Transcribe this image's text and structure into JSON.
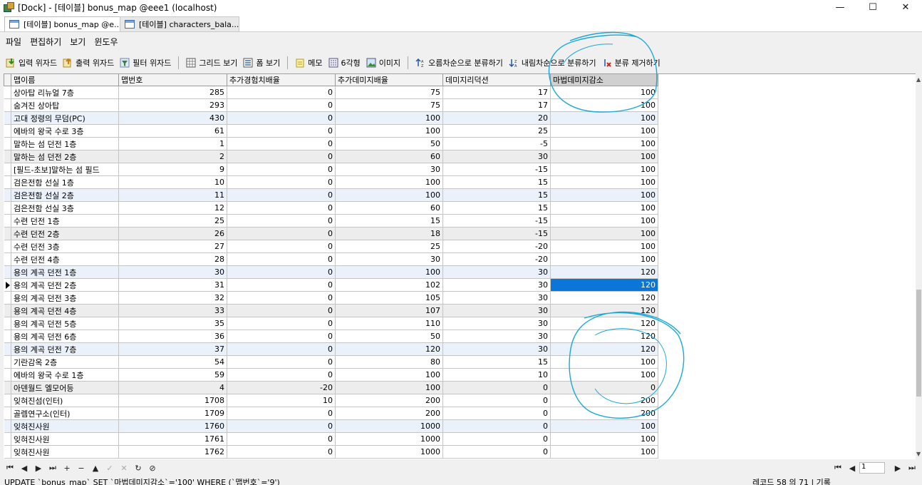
{
  "window": {
    "title": "[Dock] - [테이블] bonus_map @eee1 (localhost)"
  },
  "window_controls": {
    "minimize": "—",
    "maximize": "☐",
    "close": "✕"
  },
  "tabs": [
    {
      "label": "[테이블] bonus_map @e..."
    },
    {
      "label": "[테이블] characters_bala..."
    }
  ],
  "menu": [
    "파일",
    "편집하기",
    "보기",
    "윈도우"
  ],
  "toolbar": [
    "입력 위자드",
    "출력 위자드",
    "필터 위자드",
    "그리드 보기",
    "폼 보기",
    "메모",
    "6각형",
    "이미지",
    "오름차순으로 분류하기",
    "내림차순으로 분류하기",
    "분류 제거하기"
  ],
  "columns": [
    "맵이름",
    "맵번호",
    "추가경험치배율",
    "추가데미지배율",
    "데미지리덕션",
    "마법데미지감소"
  ],
  "rows": [
    {
      "name": "상아탑 리뉴얼 7층",
      "vals": [
        "285",
        "0",
        "75",
        "17",
        "100"
      ]
    },
    {
      "name": "숨겨진 상아탑",
      "vals": [
        "293",
        "0",
        "75",
        "17",
        "100"
      ]
    },
    {
      "name": "고대 정령의 무덤(PC)",
      "vals": [
        "430",
        "0",
        "100",
        "20",
        "100"
      ]
    },
    {
      "name": "에바의 왕국 수로 3층",
      "vals": [
        "61",
        "0",
        "100",
        "25",
        "100"
      ]
    },
    {
      "name": "말하는 섬 던전 1층",
      "vals": [
        "1",
        "0",
        "50",
        "-5",
        "100"
      ]
    },
    {
      "name": "말하는 섬 던전 2층",
      "vals": [
        "2",
        "0",
        "60",
        "30",
        "100"
      ]
    },
    {
      "name": "[필드-초보]말하는 섬 필드",
      "vals": [
        "9",
        "0",
        "30",
        "-15",
        "100"
      ]
    },
    {
      "name": "검은전함 선실 1층",
      "vals": [
        "10",
        "0",
        "100",
        "15",
        "100"
      ]
    },
    {
      "name": "검은전함 선실 2층",
      "vals": [
        "11",
        "0",
        "100",
        "15",
        "100"
      ]
    },
    {
      "name": "검은전함 선실 3층",
      "vals": [
        "12",
        "0",
        "60",
        "15",
        "100"
      ]
    },
    {
      "name": "수련 던전 1층",
      "vals": [
        "25",
        "0",
        "15",
        "-15",
        "100"
      ]
    },
    {
      "name": "수련 던전 2층",
      "vals": [
        "26",
        "0",
        "18",
        "-15",
        "100"
      ]
    },
    {
      "name": "수련 던전 3층",
      "vals": [
        "27",
        "0",
        "25",
        "-20",
        "100"
      ]
    },
    {
      "name": "수련 던전 4층",
      "vals": [
        "28",
        "0",
        "30",
        "-20",
        "100"
      ]
    },
    {
      "name": "용의 계곡 던전 1층",
      "vals": [
        "30",
        "0",
        "100",
        "30",
        "120"
      ]
    },
    {
      "name": "용의 계곡 던전 2층",
      "vals": [
        "31",
        "0",
        "102",
        "30",
        "120"
      ]
    },
    {
      "name": "용의 계곡 던전 3층",
      "vals": [
        "32",
        "0",
        "105",
        "30",
        "120"
      ]
    },
    {
      "name": "용의 계곡 던전 4층",
      "vals": [
        "33",
        "0",
        "107",
        "30",
        "120"
      ]
    },
    {
      "name": "용의 계곡 던전 5층",
      "vals": [
        "35",
        "0",
        "110",
        "30",
        "120"
      ]
    },
    {
      "name": "용의 계곡 던전 6층",
      "vals": [
        "36",
        "0",
        "50",
        "30",
        "120"
      ]
    },
    {
      "name": "용의 계곡 던전 7층",
      "vals": [
        "37",
        "0",
        "120",
        "30",
        "120"
      ]
    },
    {
      "name": "기란감옥 2층",
      "vals": [
        "54",
        "0",
        "80",
        "15",
        "100"
      ]
    },
    {
      "name": "에바의 왕국 수로 1층",
      "vals": [
        "59",
        "0",
        "100",
        "10",
        "100"
      ]
    },
    {
      "name": "아덴월드 엘모어등",
      "vals": [
        "4",
        "-20",
        "100",
        "0",
        "0"
      ]
    },
    {
      "name": "잊혀진섬(인터)",
      "vals": [
        "1708",
        "10",
        "200",
        "0",
        "200"
      ]
    },
    {
      "name": "골렘연구소(인터)",
      "vals": [
        "1709",
        "0",
        "200",
        "0",
        "200"
      ]
    },
    {
      "name": "잊혀진사원",
      "vals": [
        "1760",
        "0",
        "1000",
        "0",
        "100"
      ]
    },
    {
      "name": "잊혀진사원",
      "vals": [
        "1761",
        "0",
        "1000",
        "0",
        "100"
      ]
    },
    {
      "name": "잊혀진사원",
      "vals": [
        "1762",
        "0",
        "1000",
        "0",
        "100"
      ]
    }
  ],
  "selected_row": 15,
  "nav_buttons": [
    "⏮",
    "◀",
    "▶",
    "⏭",
    "+",
    "−",
    "▲",
    "✓",
    "✕",
    "↻",
    "⊘"
  ],
  "pager": {
    "first": "⏮",
    "prev": "◀",
    "page": "1",
    "next": "▶",
    "last": "⏭"
  },
  "status": {
    "sql": "UPDATE `bonus_map` SET `마법데미지감소`='100' WHERE (`맵번호`='9')",
    "record_count": "레코드 58 의 71 | 기록"
  },
  "colors": {
    "selection": "#0a77d8",
    "annotation_ink": "#1aa8d8",
    "header_selected": "#d0d0d0"
  }
}
